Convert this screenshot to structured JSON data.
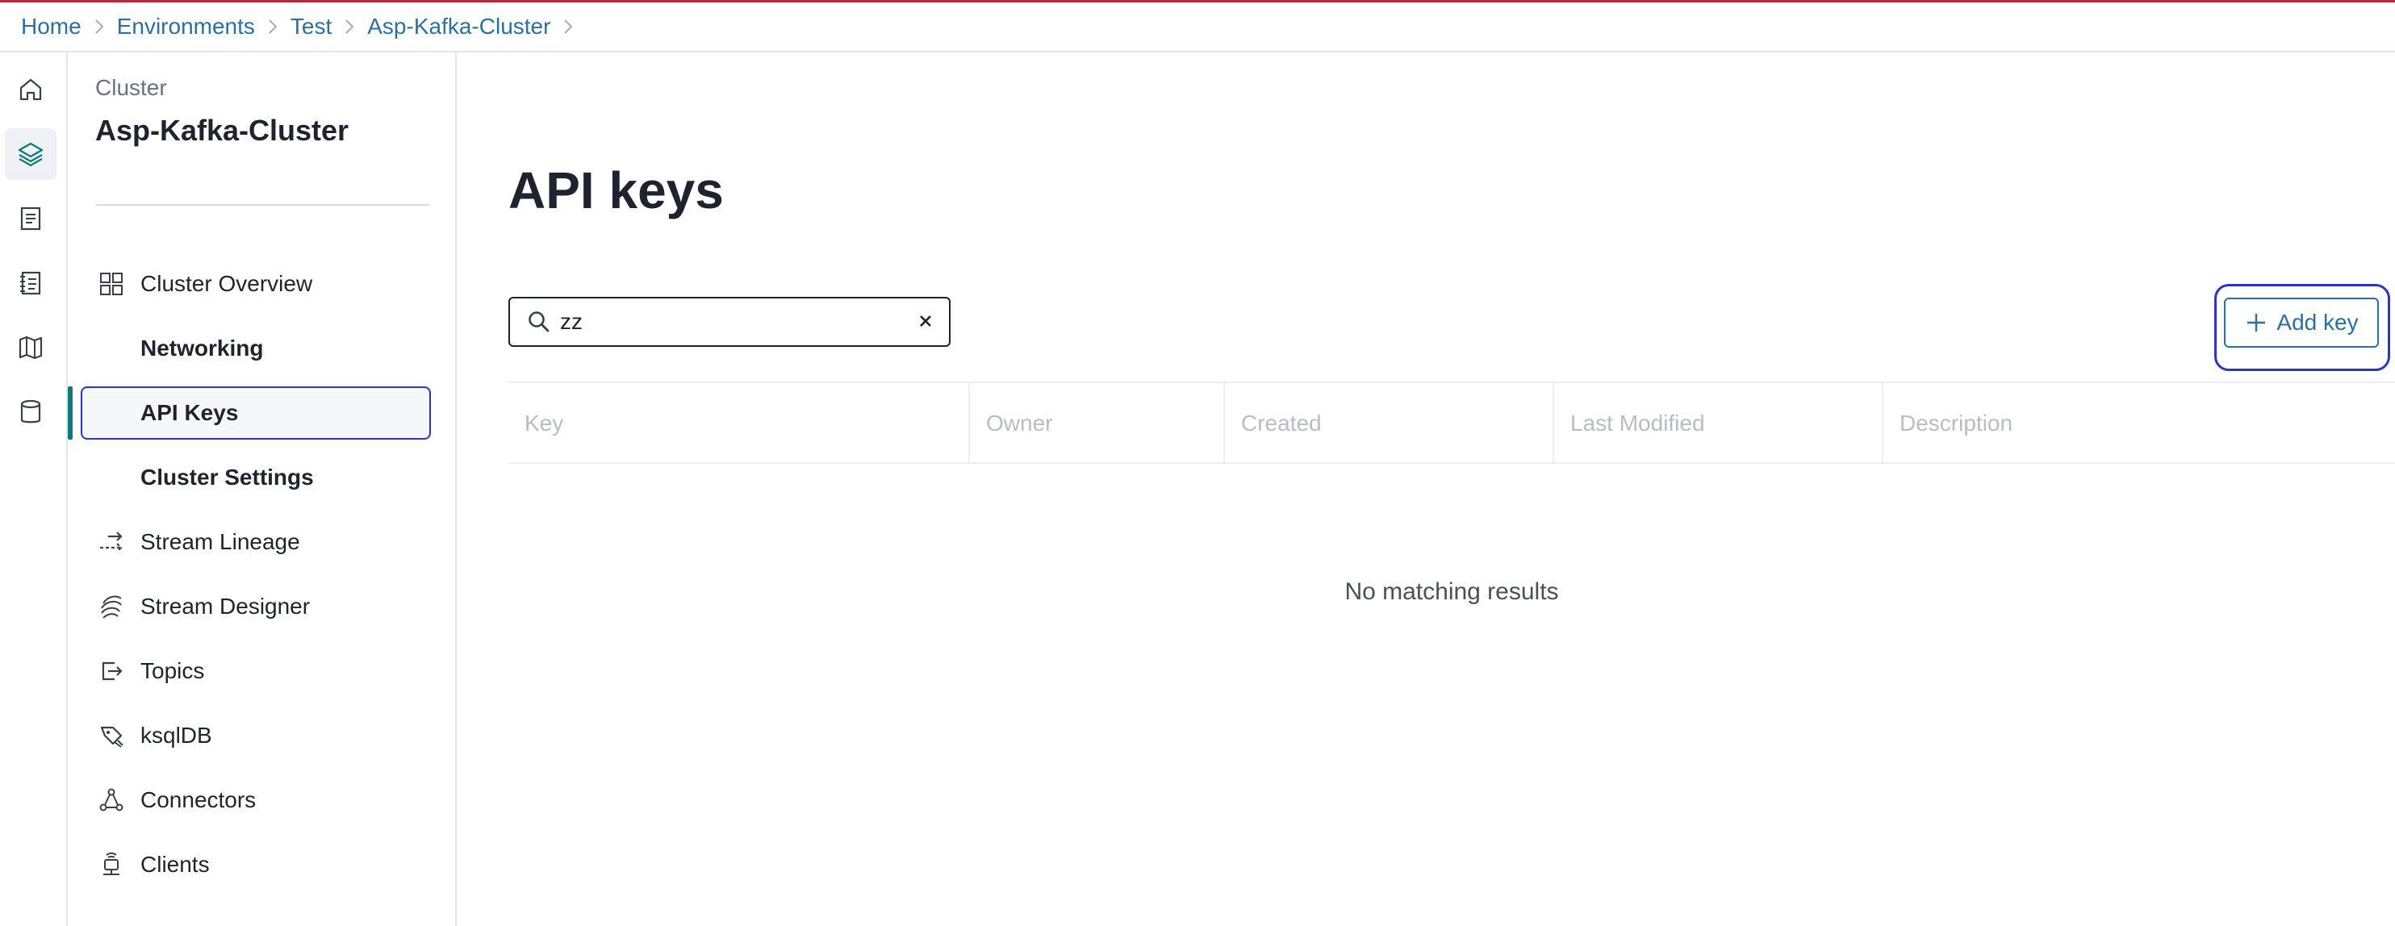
{
  "breadcrumb": [
    "Home",
    "Environments",
    "Test",
    "Asp-Kafka-Cluster"
  ],
  "rail": {
    "icons": [
      "home-icon",
      "layers-icon",
      "document-icon",
      "notebook-icon",
      "map-icon",
      "database-icon"
    ],
    "active": "layers-icon"
  },
  "sidenav": {
    "kicker": "Cluster",
    "title": "Asp-Kafka-Cluster",
    "items": [
      {
        "label": "Cluster Overview",
        "icon": "grid-icon"
      },
      {
        "label": "Networking",
        "icon": ""
      },
      {
        "label": "API Keys",
        "icon": "",
        "selected": true
      },
      {
        "label": "Cluster Settings",
        "icon": ""
      },
      {
        "label": "Stream Lineage",
        "icon": "stream-lineage-icon"
      },
      {
        "label": "Stream Designer",
        "icon": "stream-designer-icon"
      },
      {
        "label": "Topics",
        "icon": "topics-icon"
      },
      {
        "label": "ksqlDB",
        "icon": "ksqldb-icon"
      },
      {
        "label": "Connectors",
        "icon": "connectors-icon"
      },
      {
        "label": "Clients",
        "icon": "clients-icon"
      }
    ]
  },
  "main": {
    "title": "API keys",
    "search": {
      "value": "zz"
    },
    "add_button": "Add key",
    "columns": [
      "Key",
      "Owner",
      "Created",
      "Last Modified",
      "Description"
    ],
    "empty_message": "No matching results"
  },
  "colors": {
    "accent": "#2c6fa3",
    "focus": "#2d33c8",
    "active_bar": "#0f7a7a",
    "top_line": "#c0283a"
  }
}
